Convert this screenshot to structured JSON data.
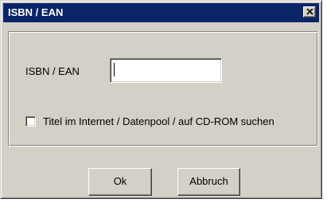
{
  "window": {
    "title": "ISBN / EAN",
    "title_bar_color": "#0a246a",
    "face_color": "#d4d0c8"
  },
  "form": {
    "isbn_label": "ISBN / EAN",
    "isbn_value": "",
    "search_checkbox_label": "Titel im Internet / Datenpool / auf CD-ROM suchen",
    "search_checkbox_checked": false
  },
  "buttons": {
    "ok_label": "Ok",
    "cancel_label": "Abbruch"
  },
  "icons": {
    "close": "close-icon"
  }
}
